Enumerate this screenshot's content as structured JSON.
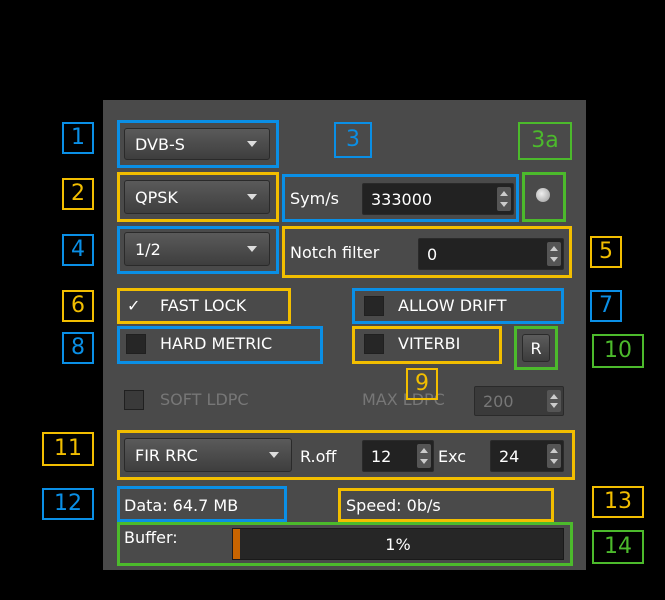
{
  "standard": {
    "value": "DVB-S"
  },
  "modulation": {
    "value": "QPSK"
  },
  "symbol_rate": {
    "label": "Sym/s",
    "value": "333000"
  },
  "code_rate": {
    "value": "1/2"
  },
  "notch_filter": {
    "label": "Notch filter",
    "value": "0"
  },
  "fast_lock": {
    "label": "FAST LOCK",
    "checked": true,
    "check_glyph": "✓"
  },
  "allow_drift": {
    "label": "ALLOW DRIFT",
    "checked": false
  },
  "hard_metric": {
    "label": "HARD METRIC",
    "checked": false
  },
  "viterbi": {
    "label": "VITERBI",
    "checked": false
  },
  "reset_button": {
    "label": "R"
  },
  "soft_ldpc": {
    "label": "SOFT LDPC",
    "enabled": false
  },
  "max_ldpc": {
    "label": "MAX LDPC",
    "value": "200",
    "enabled": false
  },
  "filter": {
    "value": "FIR RRC",
    "rolloff_label": "R.off",
    "rolloff_value": "12",
    "excess_label": "Exc",
    "excess_value": "24"
  },
  "data_count": {
    "text": "Data: 64.7 MB"
  },
  "speed": {
    "text": "Speed: 0b/s"
  },
  "buffer": {
    "label": "Buffer:",
    "percent_text": "1%",
    "fill_fraction": 0.01
  },
  "status_indicator": {
    "icon": "status-led-icon",
    "color": "#cccccc"
  },
  "annotations": {
    "n1": "1",
    "n2": "2",
    "n3": "3",
    "n3a": "3a",
    "n4": "4",
    "n5": "5",
    "n6": "6",
    "n7": "7",
    "n8": "8",
    "n9": "9",
    "n10": "10",
    "n11": "11",
    "n12": "12",
    "n13": "13",
    "n14": "14"
  },
  "colors": {
    "yellow": "#f2be00",
    "blue": "#0a8fe6",
    "green": "#4cba2c"
  }
}
